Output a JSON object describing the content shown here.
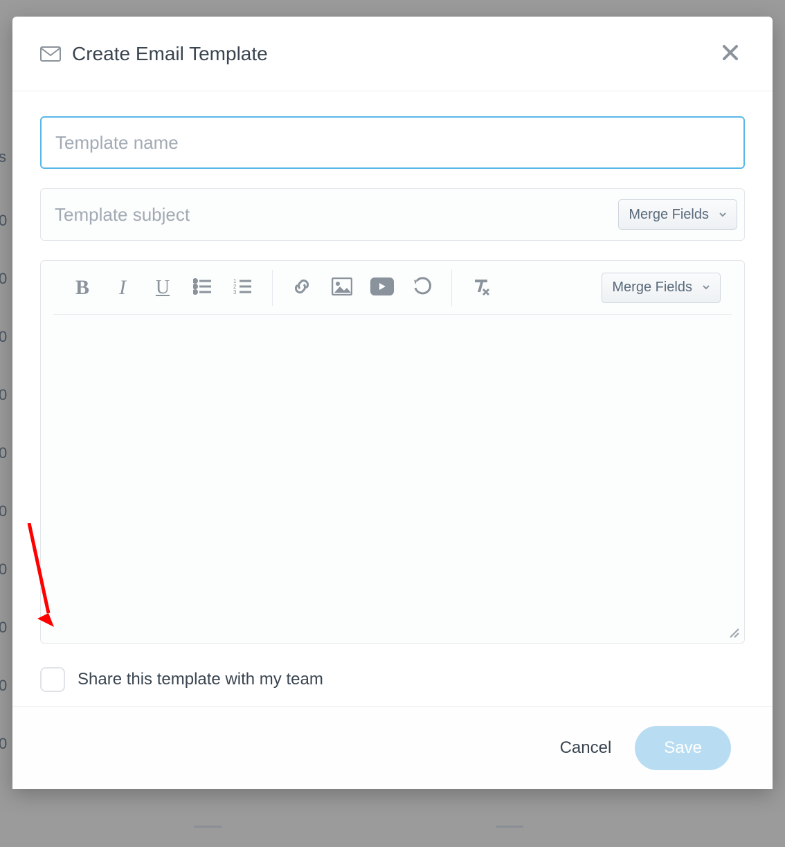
{
  "header": {
    "title": "Create Email Template"
  },
  "inputs": {
    "template_name_placeholder": "Template name",
    "template_subject_placeholder": "Template subject"
  },
  "buttons": {
    "merge_fields": "Merge Fields",
    "cancel": "Cancel",
    "save": "Save"
  },
  "share": {
    "label": "Share this template with my team"
  },
  "toolbar_icons": [
    "bold-icon",
    "italic-icon",
    "underline-icon",
    "bullet-list-icon",
    "numbered-list-icon",
    "link-icon",
    "image-icon",
    "video-icon",
    "undo-icon",
    "clear-format-icon"
  ],
  "background": {
    "grid_marker": "0",
    "truncated_text": "s"
  }
}
